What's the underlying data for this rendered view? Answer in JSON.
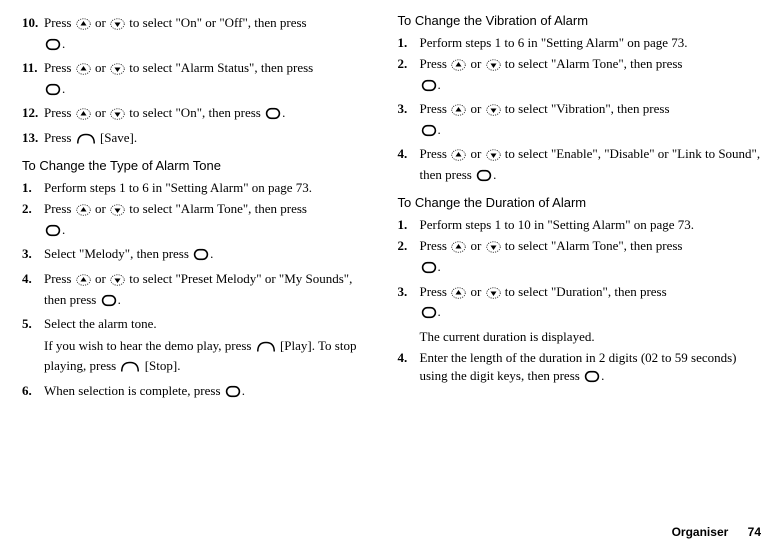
{
  "left": {
    "step10": {
      "num": "10.",
      "t1": "Press ",
      "t2": " or ",
      "t3": " to select \"On\" or \"Off\", then press ",
      "t4": "."
    },
    "step11": {
      "num": "11.",
      "t1": "Press ",
      "t2": " or ",
      "t3": " to select \"Alarm Status\", then press ",
      "t4": "."
    },
    "step12": {
      "num": "12.",
      "t1": "Press ",
      "t2": " or ",
      "t3": " to select \"On\", then press ",
      "t4": "."
    },
    "step13": {
      "num": "13.",
      "t1": "Press ",
      "t2": " [Save]."
    },
    "headingType": "To Change the Type of Alarm Tone",
    "step1": {
      "num": "1.",
      "t1": "Perform steps 1 to 6 in \"Setting Alarm\" on page 73."
    },
    "step2": {
      "num": "2.",
      "t1": "Press ",
      "t2": " or ",
      "t3": " to select \"Alarm Tone\", then press ",
      "t4": "."
    },
    "step3": {
      "num": "3.",
      "t1": "Select \"Melody\", then press ",
      "t2": "."
    },
    "step4": {
      "num": "4.",
      "t1": "Press ",
      "t2": " or ",
      "t3": " to select \"Preset Melody\" or \"My Sounds\", then press ",
      "t4": "."
    },
    "step5": {
      "num": "5.",
      "t1": "Select the alarm tone.",
      "c1": "If you wish to hear the demo play, press ",
      "c2": " [Play]. To stop playing, press ",
      "c3": " [Stop]."
    },
    "step6": {
      "num": "6.",
      "t1": "When selection is complete, press ",
      "t2": "."
    }
  },
  "right": {
    "headingVib": "To Change the Vibration of Alarm",
    "v1": {
      "num": "1.",
      "t1": "Perform steps 1 to 6 in \"Setting Alarm\" on page 73."
    },
    "v2": {
      "num": "2.",
      "t1": "Press ",
      "t2": " or ",
      "t3": " to select \"Alarm Tone\", then press ",
      "t4": "."
    },
    "v3": {
      "num": "3.",
      "t1": "Press ",
      "t2": " or ",
      "t3": " to select \"Vibration\", then press ",
      "t4": "."
    },
    "v4": {
      "num": "4.",
      "t1": "Press ",
      "t2": " or ",
      "t3": " to select \"Enable\", \"Disable\" or \"Link to Sound\", then press ",
      "t4": "."
    },
    "headingDur": "To Change the Duration of Alarm",
    "d1": {
      "num": "1.",
      "t1": "Perform steps 1 to 10 in \"Setting Alarm\" on page 73."
    },
    "d2": {
      "num": "2.",
      "t1": "Press ",
      "t2": " or ",
      "t3": " to select \"Alarm Tone\", then press ",
      "t4": "."
    },
    "d3": {
      "num": "3.",
      "t1": "Press ",
      "t2": " or ",
      "t3": " to select \"Duration\", then press ",
      "t4": ".",
      "c1": "The current duration is displayed."
    },
    "d4": {
      "num": "4.",
      "t1": "Enter the length of the duration in 2 digits (02 to 59 seconds) using the digit keys, then press ",
      "t2": "."
    }
  },
  "footer": {
    "label": "Organiser",
    "page": "74"
  }
}
